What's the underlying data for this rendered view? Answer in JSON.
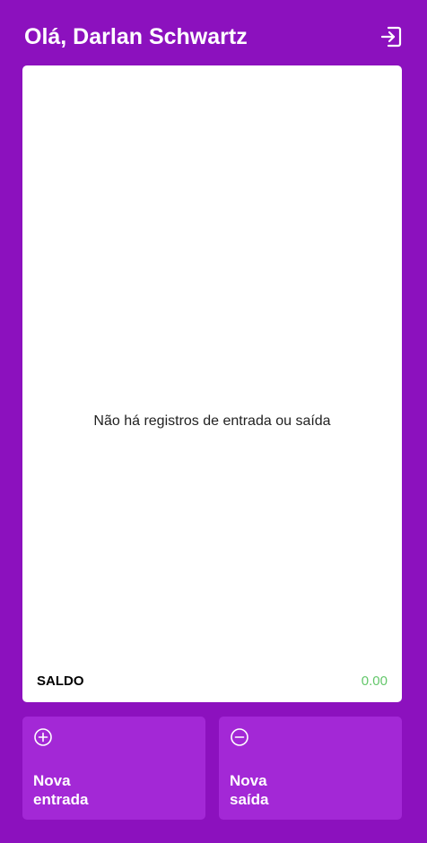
{
  "header": {
    "greeting": "Olá, Darlan Schwartz",
    "logout_icon": "logout-icon"
  },
  "records": {
    "empty_message": "Não há registros de entrada ou saída",
    "saldo_label": "SALDO",
    "saldo_value": "0.00"
  },
  "actions": {
    "entrada": {
      "label": "Nova\nentrada",
      "icon": "plus-circle-icon"
    },
    "saida": {
      "label": "Nova\nsaída",
      "icon": "minus-circle-icon"
    }
  },
  "colors": {
    "background": "#8c11be",
    "button": "#a328d6",
    "positive": "#63c76a"
  }
}
